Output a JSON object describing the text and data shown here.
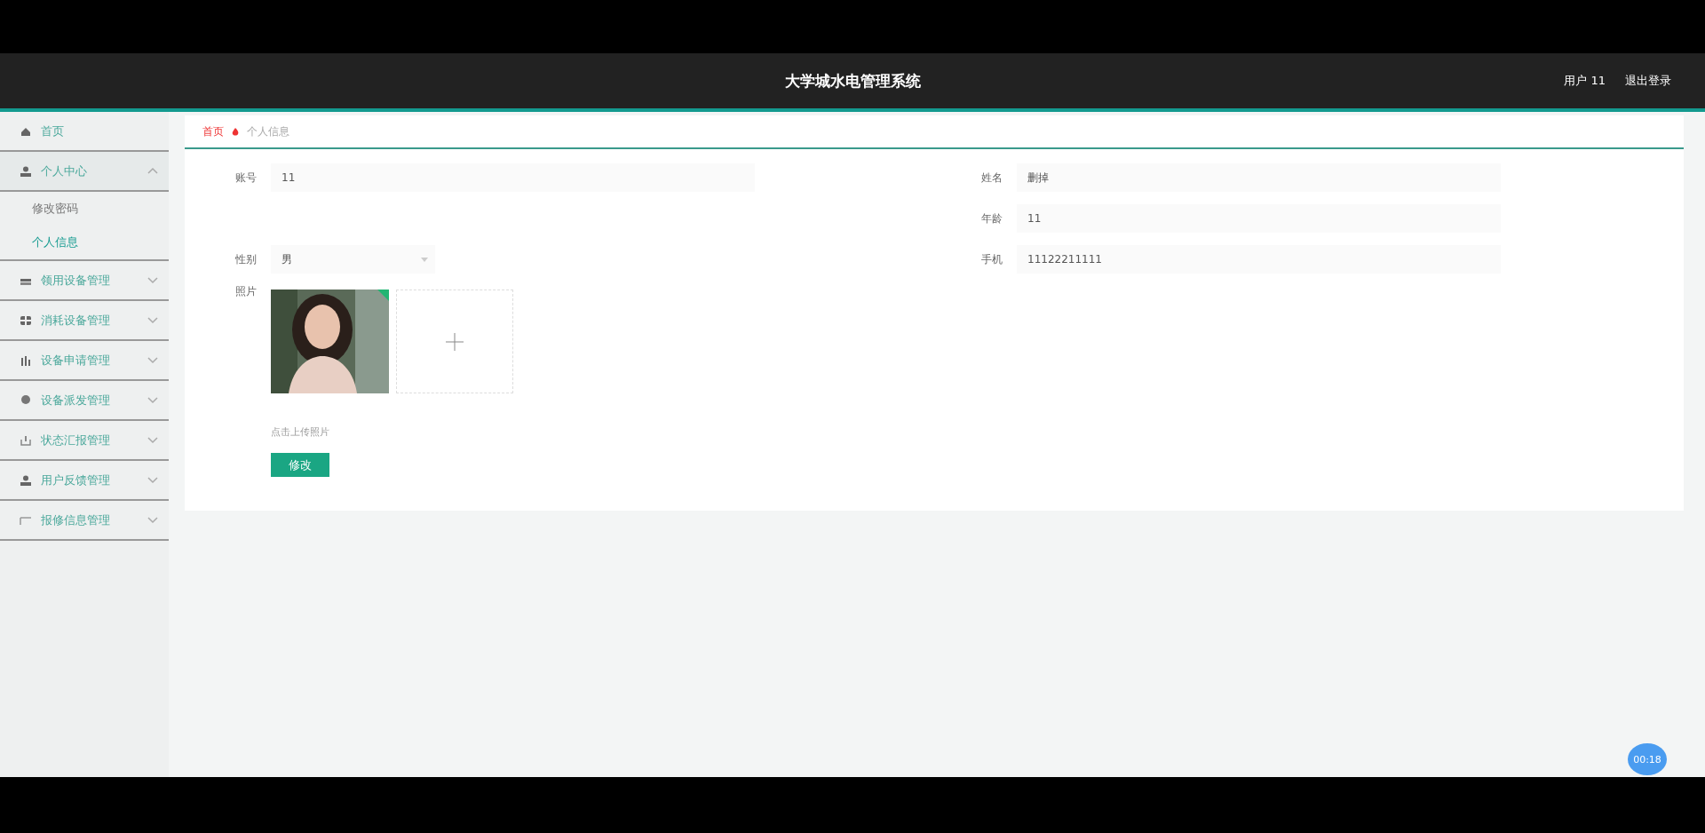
{
  "header": {
    "title": "大学城水电管理系统",
    "user": "用户 11",
    "logout": "退出登录"
  },
  "sidebar": {
    "items": [
      {
        "label": "首页"
      },
      {
        "label": "个人中心",
        "expanded": true,
        "children": [
          {
            "label": "修改密码",
            "selected": false
          },
          {
            "label": "个人信息",
            "selected": true
          }
        ]
      },
      {
        "label": "领用设备管理",
        "expanded": false
      },
      {
        "label": "消耗设备管理",
        "expanded": false
      },
      {
        "label": "设备申请管理",
        "expanded": false
      },
      {
        "label": "设备派发管理",
        "expanded": false
      },
      {
        "label": "状态汇报管理",
        "expanded": false
      },
      {
        "label": "用户反馈管理",
        "expanded": false
      },
      {
        "label": "报修信息管理",
        "expanded": false
      }
    ]
  },
  "breadcrumb": {
    "home": "首页",
    "current": "个人信息"
  },
  "form": {
    "account": {
      "label": "账号",
      "value": "11"
    },
    "name": {
      "label": "姓名",
      "value": "删掉"
    },
    "age": {
      "label": "年龄",
      "value": "11"
    },
    "gender": {
      "label": "性别",
      "value": "男"
    },
    "phone": {
      "label": "手机",
      "value": "11122211111"
    },
    "photo": {
      "label": "照片",
      "hint": "点击上传照片"
    },
    "submit": "修改"
  },
  "timer": "00:18"
}
